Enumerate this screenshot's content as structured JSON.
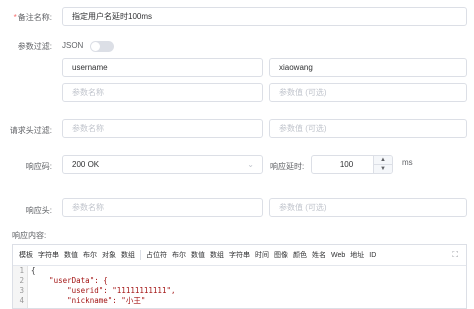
{
  "form": {
    "remark": {
      "label": "备注名称:",
      "value": "指定用户名延时100ms"
    },
    "param_filter": {
      "label": "参数过滤:",
      "json_label": "JSON",
      "json_enabled": false,
      "rows": [
        {
          "name": "username",
          "value": "xiaowang"
        },
        {
          "name_placeholder": "参数名称",
          "value_placeholder": "参数值 (可选)"
        }
      ]
    },
    "header_filter": {
      "label": "请求头过滤:",
      "name_placeholder": "参数名称",
      "value_placeholder": "参数值 (可选)"
    },
    "response_code": {
      "label": "响应码:",
      "value": "200 OK"
    },
    "response_delay": {
      "label": "响应延时:",
      "value": "100",
      "unit": "ms",
      "up_icon": "▲",
      "down_icon": "▼"
    },
    "response_header": {
      "label": "响应头:",
      "name_placeholder": "参数名称",
      "value_placeholder": "参数值 (可选)"
    },
    "response_body": {
      "label": "响应内容:"
    }
  },
  "editor": {
    "toolbar_group1": [
      "模板",
      "字符串",
      "数值",
      "布尔",
      "对象",
      "数组"
    ],
    "toolbar_group2": [
      "占位符",
      "布尔",
      "数值",
      "数组",
      "字符串",
      "时间",
      "图像",
      "颜色",
      "姓名",
      "Web",
      "地址",
      "ID"
    ],
    "expand_icon": "⛶",
    "select_arrow": "⌄",
    "lines": [
      {
        "num": "1",
        "text": "{"
      },
      {
        "num": "2",
        "text": "    \"userData\": {"
      },
      {
        "num": "3",
        "text": "        \"userid\": \"11111111111\","
      },
      {
        "num": "4",
        "text": "        \"nickname\": \"小王\""
      }
    ]
  }
}
